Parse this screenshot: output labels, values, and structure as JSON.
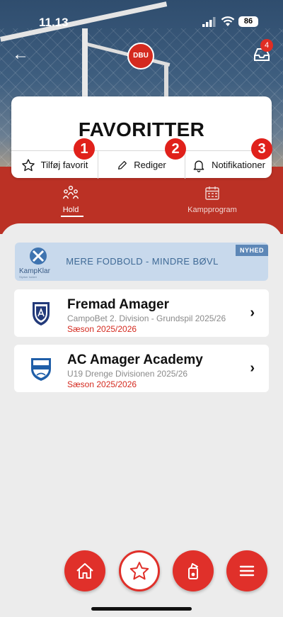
{
  "status_bar": {
    "time": "11.13",
    "battery": "86"
  },
  "header": {
    "logo_text": "DBU",
    "inbox_badge": "4"
  },
  "card": {
    "title": "FAVORITTER",
    "actions": [
      {
        "label": "Tilføj favorit",
        "icon": "star-icon"
      },
      {
        "label": "Rediger",
        "icon": "pencil-icon"
      },
      {
        "label": "Notifikationer",
        "icon": "bell-icon"
      }
    ],
    "markers": [
      "1",
      "2",
      "3"
    ]
  },
  "tabs": [
    {
      "label": "Hold",
      "active": true
    },
    {
      "label": "Kampprogram",
      "active": false
    }
  ],
  "promo": {
    "brand": "KampKlar",
    "tagline": "Styrker holdet",
    "text": "MERE FODBOLD - MINDRE BØVL",
    "badge": "NYHED"
  },
  "teams": [
    {
      "name": "Fremad Amager",
      "division": "CampoBet 2. Division - Grundspil 2025/26",
      "season": "Sæson 2025/2026"
    },
    {
      "name": "AC Amager Academy",
      "division": "U19 Drenge Divisionen 2025/26",
      "season": "Sæson 2025/2026"
    }
  ],
  "bottom_nav": [
    "home-icon",
    "star-icon",
    "whistle-icon",
    "menu-icon"
  ],
  "colors": {
    "accent": "#e0302a",
    "promo_bg": "#c8d9ec",
    "season_red": "#d42a1f"
  }
}
